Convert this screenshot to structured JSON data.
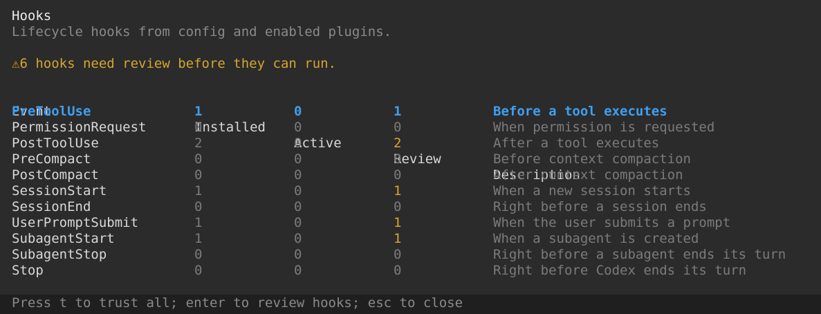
{
  "panel": {
    "title": "Hooks",
    "subtitle": "Lifecycle hooks from config and enabled plugins.",
    "warning_icon": "⚠",
    "warning_icon_name": "warning-icon",
    "warning_text": "6 hooks need review before they can run."
  },
  "table": {
    "headers": {
      "event": "Event",
      "installed": "Installed",
      "active": "Active",
      "review": "Review",
      "description": "Description"
    },
    "rows": [
      {
        "event": "PreToolUse",
        "installed": "1",
        "active": "0",
        "review": "1",
        "description": "Before a tool executes",
        "selected": true
      },
      {
        "event": "PermissionRequest",
        "installed": "0",
        "active": "0",
        "review": "0",
        "description": "When permission is requested",
        "selected": false
      },
      {
        "event": "PostToolUse",
        "installed": "2",
        "active": "0",
        "review": "2",
        "description": "After a tool executes",
        "selected": false
      },
      {
        "event": "PreCompact",
        "installed": "0",
        "active": "0",
        "review": "0",
        "description": "Before context compaction",
        "selected": false
      },
      {
        "event": "PostCompact",
        "installed": "0",
        "active": "0",
        "review": "0",
        "description": "After context compaction",
        "selected": false
      },
      {
        "event": "SessionStart",
        "installed": "1",
        "active": "0",
        "review": "1",
        "description": "When a new session starts",
        "selected": false
      },
      {
        "event": "SessionEnd",
        "installed": "0",
        "active": "0",
        "review": "0",
        "description": "Right before a session ends",
        "selected": false
      },
      {
        "event": "UserPromptSubmit",
        "installed": "1",
        "active": "0",
        "review": "1",
        "description": "When the user submits a prompt",
        "selected": false
      },
      {
        "event": "SubagentStart",
        "installed": "1",
        "active": "0",
        "review": "1",
        "description": "When a subagent is created",
        "selected": false
      },
      {
        "event": "SubagentStop",
        "installed": "0",
        "active": "0",
        "review": "0",
        "description": "Right before a subagent ends its turn",
        "selected": false
      },
      {
        "event": "Stop",
        "installed": "0",
        "active": "0",
        "review": "0",
        "description": "Right before Codex ends its turn",
        "selected": false
      }
    ]
  },
  "footer": {
    "hint": "Press t to trust all; enter to review hooks; esc to close"
  },
  "colors": {
    "background": "#2b2b2b",
    "footer_background": "#1f1f1f",
    "selected": "#3f9ff0",
    "warning": "#d4a72c",
    "dim": "#7b7b7b"
  }
}
